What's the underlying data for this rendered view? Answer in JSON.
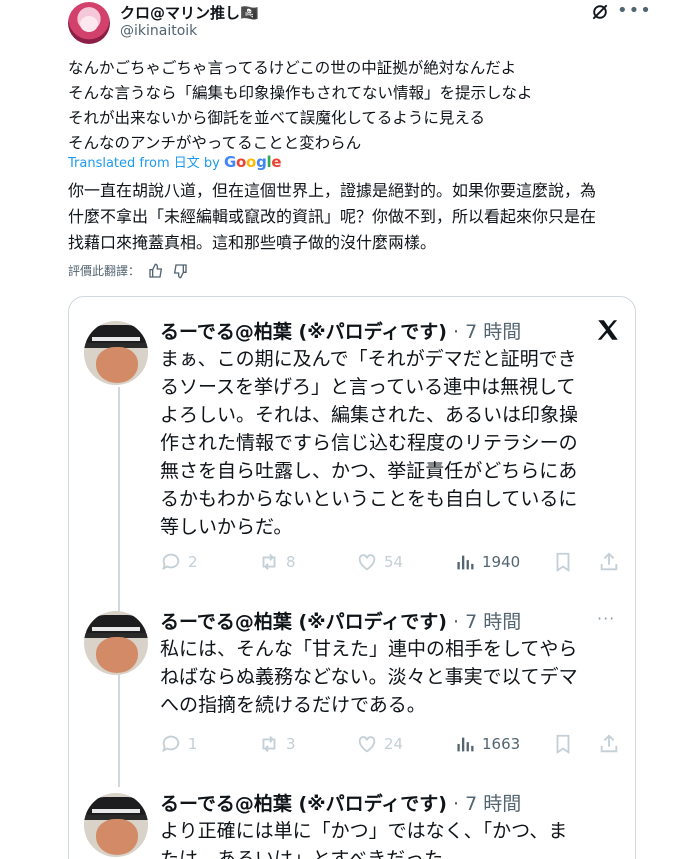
{
  "author": {
    "display_name": "クロ@マリン推し",
    "badge": "🏴‍☠️",
    "handle": "@ikinaitoik"
  },
  "tweet_lines": [
    "なんかごちゃごちゃ言ってるけどこの世の中証拠が絶対なんだよ",
    "そんな言うなら「編集も印象操作もされてない情報」を提示しなよ",
    "それが出来ないから御託を並べて誤魔化してるように見える",
    "そんなのアンチがやってることと変わらん"
  ],
  "translation": {
    "prefix": "Translated from 日文 by",
    "google": [
      "G",
      "o",
      "o",
      "g",
      "l",
      "e"
    ],
    "lines": [
      "你一直在胡說八道，但在這個世界上，證據是絕對的。如果你要這麼說，為",
      "什麼不拿出「未經編輯或竄改的資訊」呢？你做不到，所以看起來你只是在",
      "找藉口來掩蓋真相。這和那些噴子做的沒什麼兩樣。"
    ],
    "rate_label": "評價此翻譯："
  },
  "quoted_tweets": [
    {
      "name": "るーでる@柏葉 (※パロディです)",
      "time": "· 7 時間",
      "lines": [
        "まぁ、この期に及んで「それがデマだと証明でき",
        "るソースを挙げろ」と言っている連中は無視して",
        "よろしい。それは、編集された、あるいは印象操",
        "作された情報ですら信じ込む程度のリテラシーの",
        "無さを自ら吐露し、かつ、挙証責任がどちらにあ",
        "るかもわからないということをも自白しているに",
        "等しいからだ。"
      ],
      "replies": "2",
      "retweets": "8",
      "likes": "54",
      "views": "1940"
    },
    {
      "name": "るーでる@柏葉 (※パロディです)",
      "time": "· 7 時間",
      "more": "···",
      "lines": [
        "私には、そんな「甘えた」連中の相手をしてやら",
        "ねばならぬ義務などない。淡々と事実で以てデマ",
        "への指摘を続けるだけである。"
      ],
      "replies": "1",
      "retweets": "3",
      "likes": "24",
      "views": "1663"
    },
    {
      "name": "るーでる@柏葉 (※パロディです)",
      "time": "· 7 時間",
      "lines": [
        "より正確には単に「かつ」ではなく、「かつ、ま",
        "たは、あるいは」とすべきだった。"
      ]
    }
  ],
  "colors": {
    "accent": "#1d9bf0",
    "text": "#0f1419",
    "muted": "#536471",
    "border": "#cfd9de"
  }
}
